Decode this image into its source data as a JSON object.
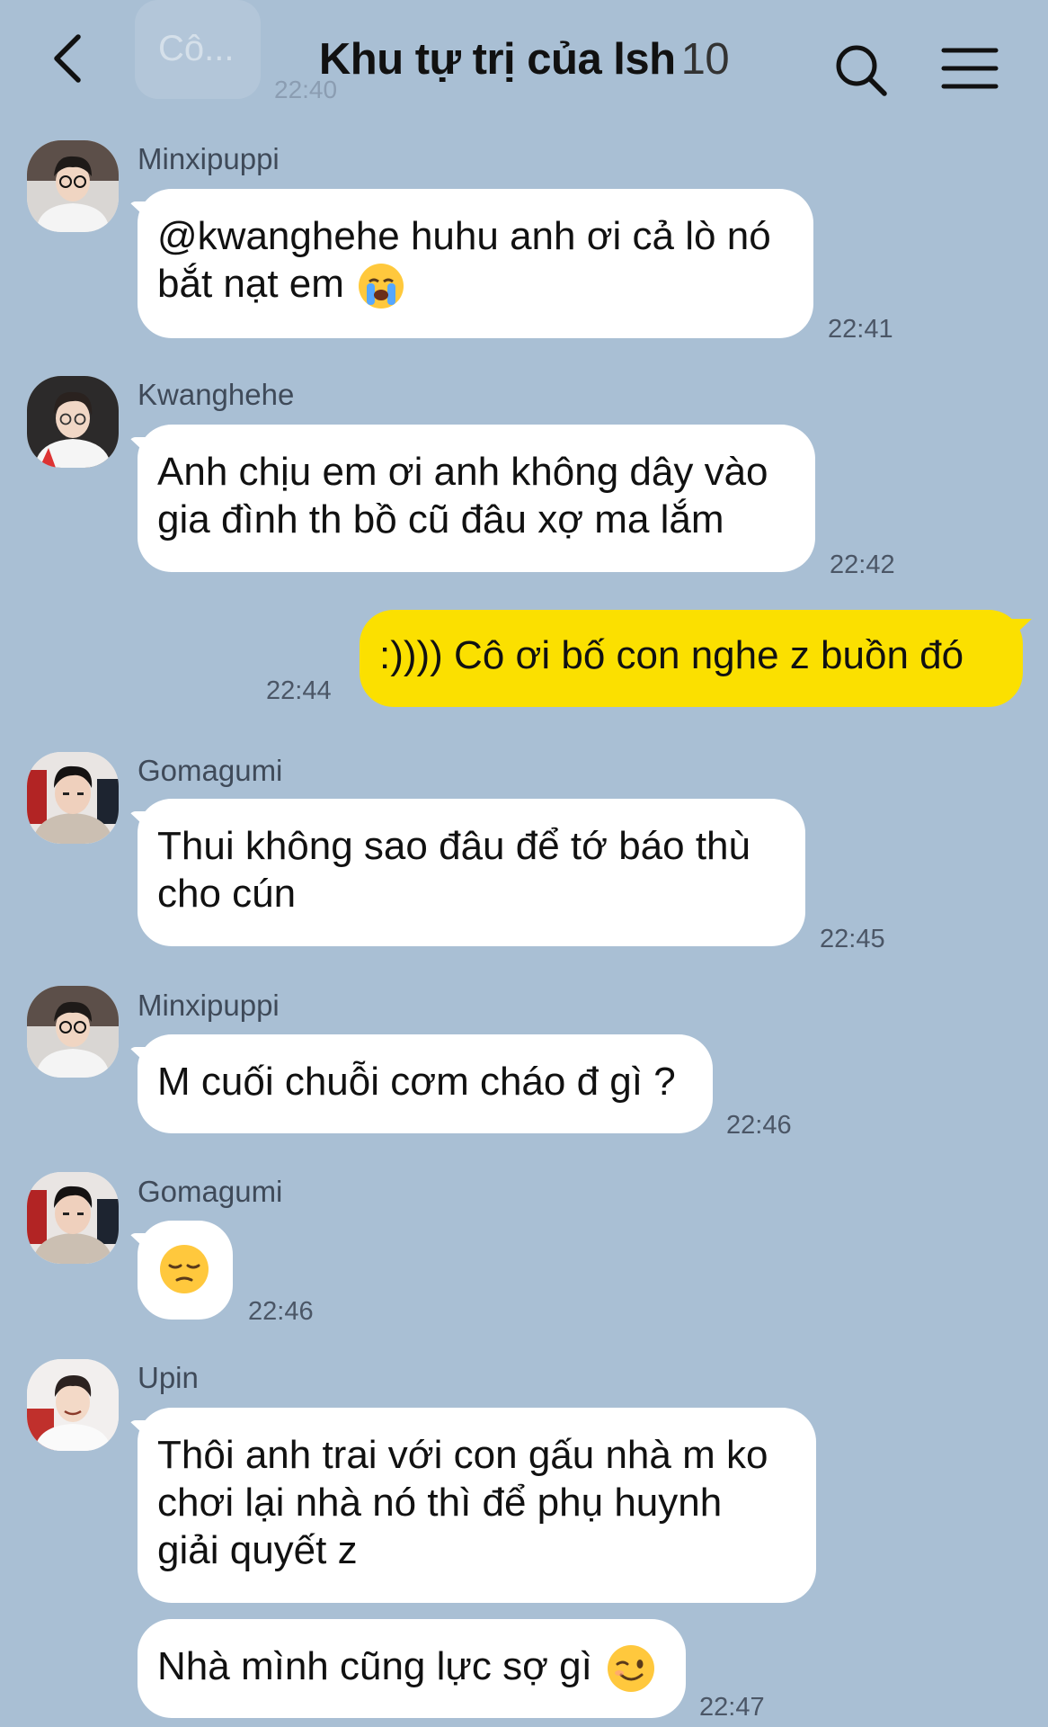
{
  "header": {
    "title": "Khu tự trị của lsh",
    "member_count": "10"
  },
  "ghost": {
    "text": "Cô...",
    "time": "22:40"
  },
  "messages": [
    {
      "sender": "Minxipuppi",
      "lines": [
        "@kwanghehe huhu anh ơi cả lò nó",
        "bắt nạt em"
      ],
      "emoji": "loudly-crying-face-emoji",
      "time": "22:41"
    },
    {
      "sender": "Kwanghehe",
      "lines": [
        "Anh chịu em ơi anh không dây vào",
        "gia đình th bồ cũ đâu xợ ma lắm"
      ],
      "time": "22:42"
    },
    {
      "sender": "",
      "lines": [
        ":)))) Cô ơi bố con nghe z buồn đó"
      ],
      "time": "22:44",
      "mine": true
    },
    {
      "sender": "Gomagumi",
      "lines": [
        "Thui không sao đâu để tớ báo thù",
        "cho cún"
      ],
      "time": "22:45"
    },
    {
      "sender": "Minxipuppi",
      "lines": [
        "M cuối chuỗi cơm cháo đ gì ?"
      ],
      "time": "22:46"
    },
    {
      "sender": "Gomagumi",
      "lines": [],
      "emoji": "pensive-face-emoji",
      "time": "22:46"
    },
    {
      "sender": "Upin",
      "lines": [
        "Thôi anh trai với con gấu nhà m ko",
        "chơi lại nhà nó thì để phụ huynh",
        "giải quyết z"
      ]
    },
    {
      "sender": "",
      "lines": [
        "Nhà mình cũng lực sợ gì"
      ],
      "emoji": "winking-face-emoji",
      "time": "22:47"
    }
  ],
  "icons": {
    "back": "chevron-left-icon",
    "search": "search-icon",
    "menu": "hamburger-menu-icon"
  },
  "colors": {
    "background": "#a9bfd4",
    "own_bubble": "#fbe000",
    "other_bubble": "#ffffff"
  }
}
